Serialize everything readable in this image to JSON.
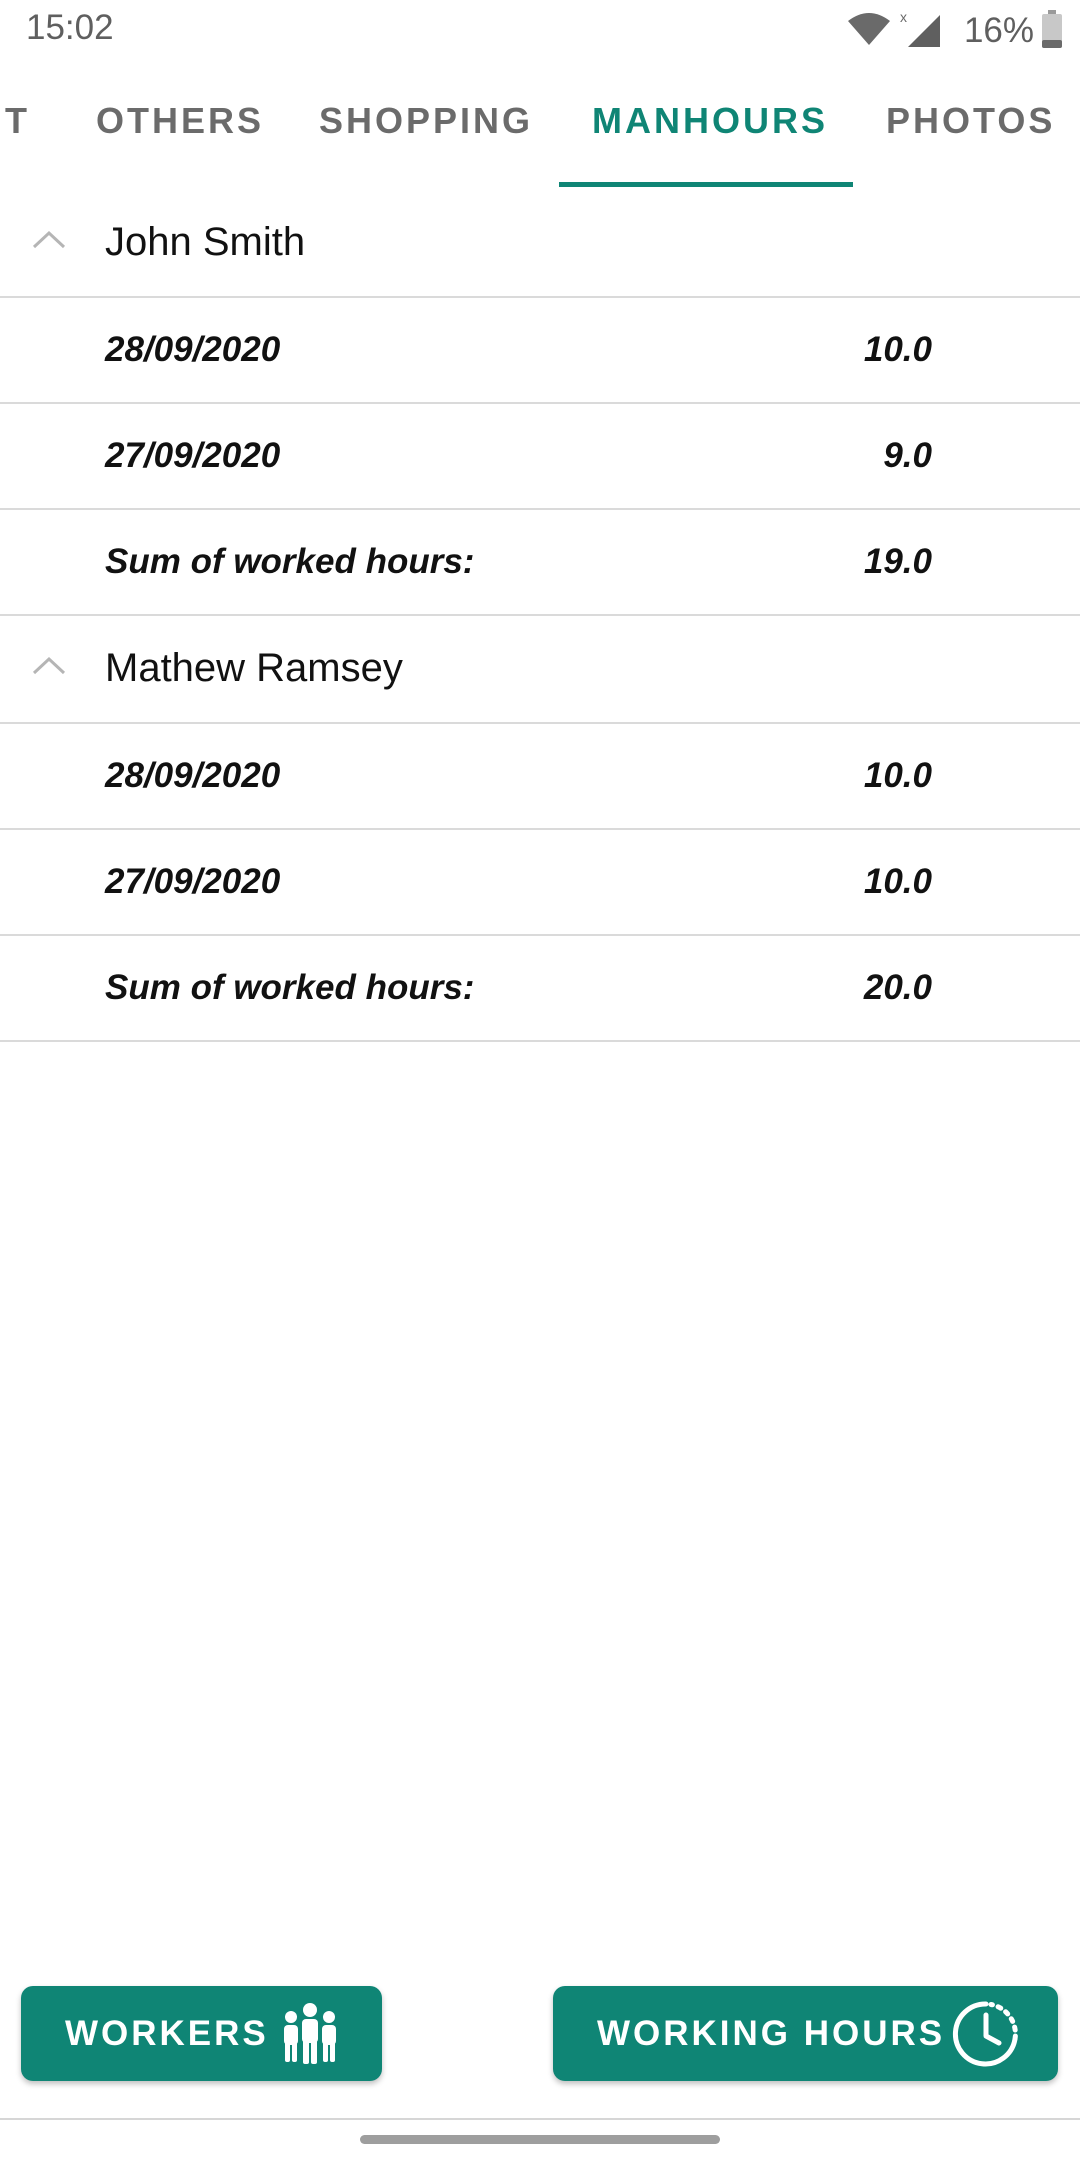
{
  "status_bar": {
    "time": "15:02",
    "battery": "16%",
    "icons": [
      "wifi-icon",
      "cell-signal-icon",
      "battery-icon"
    ]
  },
  "tabs": [
    {
      "label": "IT"
    },
    {
      "label": "OTHERS"
    },
    {
      "label": "SHOPPING"
    },
    {
      "label": "MANHOURS",
      "active": true
    },
    {
      "label": "PHOTOS"
    }
  ],
  "groups": [
    {
      "name": "John Smith",
      "entries": [
        {
          "label": "28/09/2020",
          "value": "10.0"
        },
        {
          "label": "27/09/2020",
          "value": "9.0"
        }
      ],
      "sum_label": "Sum of worked hours:",
      "sum_value": "19.0"
    },
    {
      "name": "Mathew Ramsey",
      "entries": [
        {
          "label": "28/09/2020",
          "value": "10.0"
        },
        {
          "label": "27/09/2020",
          "value": "10.0"
        }
      ],
      "sum_label": "Sum of worked hours:",
      "sum_value": "20.0"
    }
  ],
  "buttons": {
    "workers": {
      "label": "WORKERS",
      "icon": "people-icon"
    },
    "working_hours": {
      "label": "WORKING HOURS",
      "icon": "clock-history-icon"
    }
  },
  "colors": {
    "accent": "#0f8575",
    "tab_inactive": "#6b6b6b",
    "divider": "#dadada"
  }
}
